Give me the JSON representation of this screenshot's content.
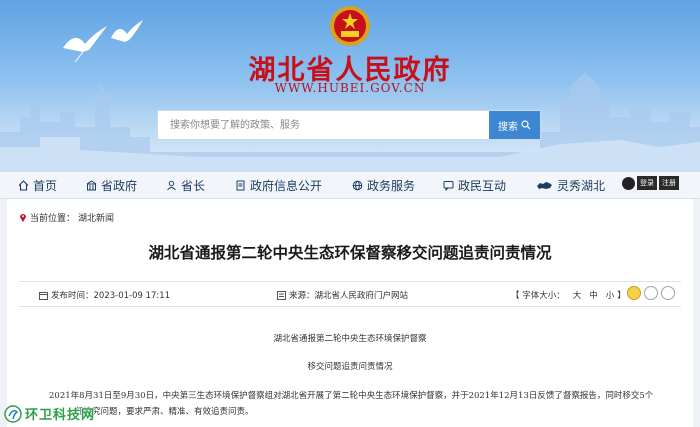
{
  "site": {
    "title": "湖北省人民政府",
    "url": "WWW.HUBEI.GOV.CN"
  },
  "search": {
    "placeholder": "搜索你想要了解的政策、服务",
    "button_label": "搜索"
  },
  "nav": {
    "items": [
      {
        "label": "首页",
        "icon": "home-icon"
      },
      {
        "label": "省政府",
        "icon": "building-icon"
      },
      {
        "label": "省长",
        "icon": "person-icon"
      },
      {
        "label": "政府信息公开",
        "icon": "document-icon"
      },
      {
        "label": "政务服务",
        "icon": "globe-icon"
      },
      {
        "label": "政民互动",
        "icon": "chat-icon"
      },
      {
        "label": "灵秀湖北",
        "icon": "map-icon"
      }
    ],
    "login_label": "登录",
    "register_label": "注册"
  },
  "breadcrumb": {
    "prefix": "当前位置：",
    "current": "湖北新闻"
  },
  "article": {
    "title": "湖北省通报第二轮中央生态环保督察移交问题追责问责情况",
    "publish_time_label": "发布时间：2023-01-09 17:11",
    "source_label": "来源：湖北省人民政府门户网站",
    "font_size_label": "【 字体大小：",
    "font_sizes": [
      "大",
      "中",
      "小"
    ],
    "font_size_close": "】",
    "heading_line1": "湖北省通报第二轮中央生态环境保护督察",
    "heading_line2": "移交问题追责问责情况",
    "para1_line1": "2021年8月31日至9月30日，中央第三生态环境保护督察组对湖北省开展了第二轮中央生态环境保护督察，并于2021年12月13日反馈了督察报告，同时移交5个",
    "para1_line2": "任追究问题，要求严肃、精准、有效追责问责。"
  },
  "watermark": {
    "text": "环卫科技网"
  },
  "colors": {
    "title_red": "#c8101b",
    "nav_text": "#1f3c62",
    "search_button": "#3d86d1",
    "banner_sky": "#6aa8e6"
  }
}
